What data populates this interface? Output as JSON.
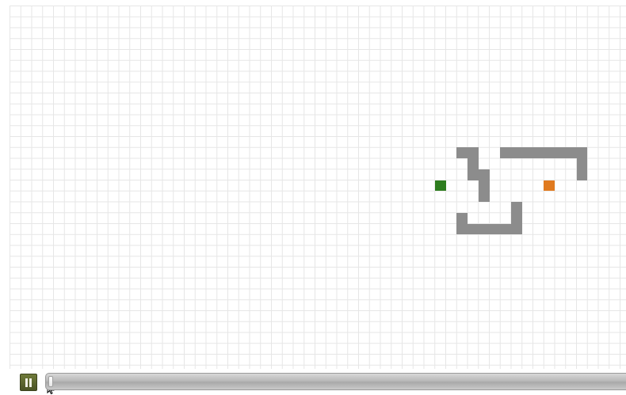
{
  "grid": {
    "cols": 57,
    "rows": 34,
    "colors": {
      "grid_line": "#e6e6e6",
      "wall": "#8c8c8c",
      "start": "#2e7d1f",
      "goal": "#e07a1f",
      "background": "#ffffff"
    },
    "start": {
      "col": 39,
      "row": 16
    },
    "goal": {
      "col": 49,
      "row": 16
    },
    "walls": [
      {
        "col": 41,
        "row": 13
      },
      {
        "col": 42,
        "row": 13
      },
      {
        "col": 42,
        "row": 14
      },
      {
        "col": 42,
        "row": 15
      },
      {
        "col": 43,
        "row": 15
      },
      {
        "col": 43,
        "row": 16
      },
      {
        "col": 43,
        "row": 17
      },
      {
        "col": 45,
        "row": 13
      },
      {
        "col": 46,
        "row": 13
      },
      {
        "col": 47,
        "row": 13
      },
      {
        "col": 48,
        "row": 13
      },
      {
        "col": 49,
        "row": 13
      },
      {
        "col": 50,
        "row": 13
      },
      {
        "col": 51,
        "row": 13
      },
      {
        "col": 52,
        "row": 13
      },
      {
        "col": 52,
        "row": 14
      },
      {
        "col": 52,
        "row": 15
      },
      {
        "col": 46,
        "row": 18
      },
      {
        "col": 46,
        "row": 19
      },
      {
        "col": 41,
        "row": 19
      },
      {
        "col": 41,
        "row": 20
      },
      {
        "col": 42,
        "row": 20
      },
      {
        "col": 43,
        "row": 20
      },
      {
        "col": 44,
        "row": 20
      },
      {
        "col": 45,
        "row": 20
      },
      {
        "col": 46,
        "row": 20
      }
    ]
  },
  "controls": {
    "pause_icon": "pause-icon",
    "cursor_icon": "cursor-arrow-icon",
    "progress": 0.0
  }
}
